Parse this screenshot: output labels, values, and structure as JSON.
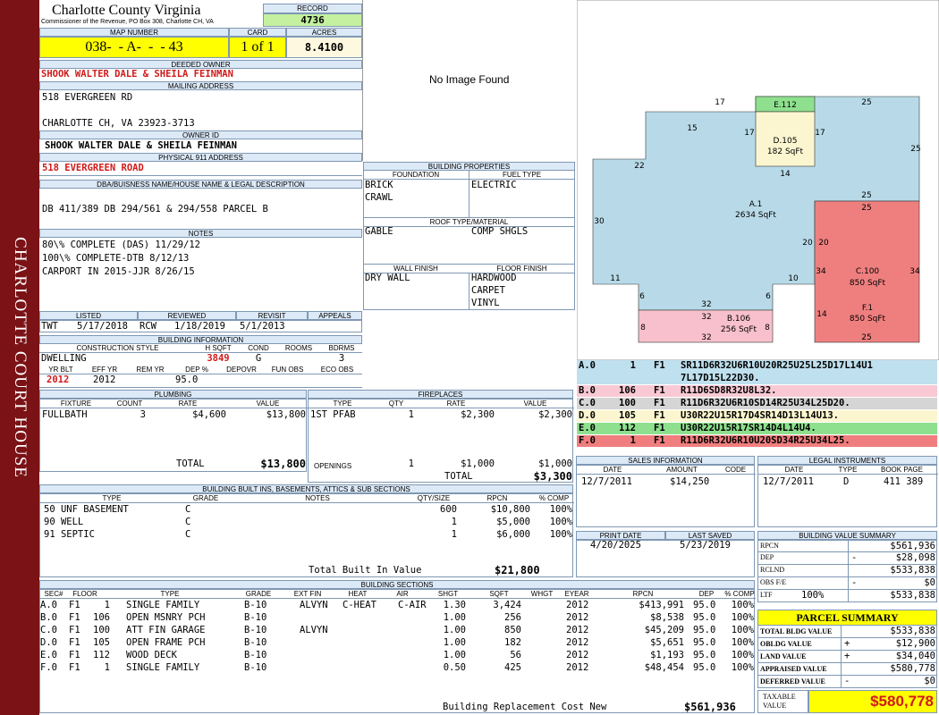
{
  "sidebar": {
    "title": "CHARLOTTE COURT HOUSE"
  },
  "header": {
    "county": "Charlotte County Virginia",
    "subtitle": "Commissioner of the Revenue, PO Box 308, Charlotte CH, VA",
    "record_label": "RECORD",
    "record": "4736",
    "map_label": "MAP NUMBER",
    "map": "038-  - A-  -  - 43",
    "card_label": "CARD",
    "card": "1 of 1",
    "acres_label": "ACRES",
    "acres": "8.4100"
  },
  "owner": {
    "deeded_label": "DEEDED OWNER",
    "deeded": "SHOOK WALTER DALE & SHEILA FEINMAN",
    "mailing_label": "MAILING ADDRESS",
    "mail1": "518 EVERGREEN RD",
    "mail2": "CHARLOTTE CH, VA 23923-3713",
    "id_label": "OWNER ID",
    "id_name": "SHOOK WALTER DALE & SHEILA FEINMAN",
    "phys_label": "PHYSICAL 911 ADDRESS",
    "phys": "518 EVERGREEN ROAD",
    "dba_label": "DBA/BUISNESS NAME/HOUSE NAME & LEGAL DESCRIPTION",
    "dba": "DB 411/389 DB 294/561 & 294/558 PARCEL B",
    "notes_label": "NOTES",
    "notes": [
      "80\\% COMPLETE (DAS) 11/29/12",
      "100\\% COMPLETE-DTB 8/12/13",
      "CARPORT IN 2015-JJR 8/26/15"
    ]
  },
  "dates": {
    "listed_label": "LISTED",
    "listed_by": "TWT",
    "listed": "5/17/2018",
    "reviewed_label": "REVIEWED",
    "reviewed_by": "RCW",
    "reviewed": "1/18/2019",
    "revisit_label": "REVISIT",
    "revisit": "5/1/2013",
    "appeals_label": "APPEALS"
  },
  "bldginfo": {
    "title": "BUILDING INFORMATION",
    "style_label": "CONSTRUCTION STYLE",
    "sqft_label": "H SQFT",
    "cond_label": "COND",
    "rooms_label": "ROOMS",
    "bdrms_label": "BDRMS",
    "style": "DWELLING",
    "sqft": "3849",
    "cond": "G",
    "bdrms": "3",
    "yr_label": "YR BLT",
    "eff_label": "EFF YR",
    "rem_label": "REM YR",
    "dep_label": "DEP %",
    "depovr_label": "DEPOVR",
    "funobs_label": "FUN OBS",
    "ecoobs_label": "ECO OBS",
    "yr": "2012",
    "eff": "2012",
    "dep": "95.0"
  },
  "image": {
    "text": "No Image Found"
  },
  "props": {
    "title": "BUILDING PROPERTIES",
    "foundation_label": "FOUNDATION",
    "fuel_label": "FUEL TYPE",
    "foundation": [
      "BRICK",
      "CRAWL"
    ],
    "fuel": "ELECTRIC",
    "roof_label": "ROOF TYPE/MATERIAL",
    "roof1": "GABLE",
    "roof2": "COMP SHGLS",
    "wall_label": "WALL FINISH",
    "floor_label": "FLOOR FINISH",
    "wall": "DRY WALL",
    "floor": [
      "HARDWOOD",
      "CARPET",
      "VINYL"
    ]
  },
  "sketch": {
    "labels": {
      "a_name": "A.1",
      "a_area": "2634 SqFt",
      "b_name": "B.106",
      "b_area": "256 SqFt",
      "c_name": "C.100",
      "c_area": "850 SqFt",
      "f_name": "F.1",
      "f_area": "850 SqFt",
      "d_name": "D.105",
      "d_area": "182 SqFt",
      "e_name": "E.112"
    },
    "dims": [
      "17",
      "25",
      "15",
      "17",
      "17",
      "25",
      "22",
      "14",
      "30",
      "25",
      "25",
      "20",
      "20",
      "34",
      "34",
      "11",
      "10",
      "6",
      "6",
      "32",
      "32",
      "14",
      "8",
      "8",
      "32",
      "25"
    ]
  },
  "vectors": [
    {
      "code": "A.0",
      "n": "1",
      "f": "F1",
      "v1": "SR11D6R32U6R10U20R25U25L25D17L14U1",
      "v2": "7L17D15L22D30.",
      "color": "#bfe0ee"
    },
    {
      "code": "B.0",
      "n": "106",
      "f": "F1",
      "v1": "R11D6SD8R32U8L32.",
      "color": "#f8c9d4"
    },
    {
      "code": "C.0",
      "n": "100",
      "f": "F1",
      "v1": "R11D6R32U6R10SD14R25U34L25D20.",
      "color": "#d5d5d5"
    },
    {
      "code": "D.0",
      "n": "105",
      "f": "F1",
      "v1": "U30R22U15R17D4SR14D13L14U13.",
      "color": "#fbf6cf"
    },
    {
      "code": "E.0",
      "n": "112",
      "f": "F1",
      "v1": "U30R22U15R17SR14D4L14U4.",
      "color": "#8ee08e"
    },
    {
      "code": "F.0",
      "n": "1",
      "f": "F1",
      "v1": "R11D6R32U6R10U20SD34R25U34L25.",
      "color": "#f07e7e"
    }
  ],
  "plumbing": {
    "title": "PLUMBING",
    "headers": [
      "FIXTURE",
      "COUNT",
      "RATE",
      "VALUE"
    ],
    "rows": [
      {
        "fixture": "FULLBATH",
        "count": "3",
        "rate": "$4,600",
        "value": "$13,800"
      }
    ],
    "total_label": "TOTAL",
    "total": "$13,800"
  },
  "fireplaces": {
    "title": "FIREPLACES",
    "headers": [
      "TYPE",
      "QTY",
      "RATE",
      "VALUE"
    ],
    "rows": [
      {
        "type": "1ST PFAB",
        "qty": "1",
        "rate": "$2,300",
        "value": "$2,300"
      }
    ],
    "openings_label": "OPENINGS",
    "op_qty": "1",
    "op_rate": "$1,000",
    "op_value": "$1,000",
    "total_label": "TOTAL",
    "total": "$3,300"
  },
  "builtins": {
    "title": "BUILDING BUILT INS, BASEMENTS, ATTICS & SUB SECTIONS",
    "headers": [
      "TYPE",
      "GRADE",
      "NOTES",
      "QTY/SIZE",
      "RPCN",
      "% COMP"
    ],
    "rows": [
      {
        "type": "50 UNF BASEMENT",
        "grade": "C",
        "qty": "600",
        "rpcn": "$10,800",
        "comp": "100%"
      },
      {
        "type": "90 WELL",
        "grade": "C",
        "qty": "1",
        "rpcn": "$5,000",
        "comp": "100%"
      },
      {
        "type": "91 SEPTIC",
        "grade": "C",
        "qty": "1",
        "rpcn": "$6,000",
        "comp": "100%"
      }
    ],
    "total_label": "Total Built In Value",
    "total": "$21,800"
  },
  "sales": {
    "title": "SALES INFORMATION",
    "headers": [
      "DATE",
      "AMOUNT",
      "CODE"
    ],
    "rows": [
      {
        "date": "12/7/2011",
        "amount": "$14,250",
        "code": ""
      }
    ]
  },
  "legal": {
    "title": "LEGAL INSTRUMENTS",
    "headers": [
      "DATE",
      "TYPE",
      "BOOK PAGE"
    ],
    "rows": [
      {
        "date": "12/7/2011",
        "type": "D",
        "book": "411 389"
      }
    ]
  },
  "print": {
    "print_label": "PRINT DATE",
    "print": "4/20/2025",
    "saved_label": "LAST SAVED",
    "saved": "5/23/2019"
  },
  "sections": {
    "title": "BUILDING SECTIONS",
    "headers": [
      "SEC#",
      "FLOOR",
      "TYPE",
      "GRADE",
      "EXT FIN",
      "HEAT",
      "AIR",
      "SHGT",
      "SQFT",
      "WHGT",
      "EYEAR",
      "RPCN",
      "DEP",
      "% COMP"
    ],
    "rows": [
      {
        "sec": "A.0",
        "floor": "F1",
        "num": "1",
        "type": "SINGLE FAMILY",
        "grade": "B-10",
        "ext": "ALVYN",
        "heat": "C-HEAT",
        "air": "C-AIR",
        "shgt": "1.30",
        "sqft": "3,424",
        "eyear": "2012",
        "rpcn": "$413,991",
        "dep": "95.0",
        "comp": "100%"
      },
      {
        "sec": "B.0",
        "floor": "F1",
        "num": "106",
        "type": "OPEN MSNRY PCH",
        "grade": "B-10",
        "ext": "",
        "heat": "",
        "air": "",
        "shgt": "1.00",
        "sqft": "256",
        "eyear": "2012",
        "rpcn": "$8,538",
        "dep": "95.0",
        "comp": "100%"
      },
      {
        "sec": "C.0",
        "floor": "F1",
        "num": "100",
        "type": "ATT FIN GARAGE",
        "grade": "B-10",
        "ext": "ALVYN",
        "heat": "",
        "air": "",
        "shgt": "1.00",
        "sqft": "850",
        "eyear": "2012",
        "rpcn": "$45,209",
        "dep": "95.0",
        "comp": "100%"
      },
      {
        "sec": "D.0",
        "floor": "F1",
        "num": "105",
        "type": "OPEN FRAME PCH",
        "grade": "B-10",
        "ext": "",
        "heat": "",
        "air": "",
        "shgt": "1.00",
        "sqft": "182",
        "eyear": "2012",
        "rpcn": "$5,651",
        "dep": "95.0",
        "comp": "100%"
      },
      {
        "sec": "E.0",
        "floor": "F1",
        "num": "112",
        "type": "WOOD DECK",
        "grade": "B-10",
        "ext": "",
        "heat": "",
        "air": "",
        "shgt": "1.00",
        "sqft": "56",
        "eyear": "2012",
        "rpcn": "$1,193",
        "dep": "95.0",
        "comp": "100%"
      },
      {
        "sec": "F.0",
        "floor": "F1",
        "num": "1",
        "type": "SINGLE FAMILY",
        "grade": "B-10",
        "ext": "",
        "heat": "",
        "air": "",
        "shgt": "0.50",
        "sqft": "425",
        "eyear": "2012",
        "rpcn": "$48,454",
        "dep": "95.0",
        "comp": "100%"
      }
    ],
    "total_label": "Building Replacement Cost New",
    "total": "$561,936"
  },
  "valuesummary": {
    "title": "BUILDING VALUE SUMMARY",
    "rows": [
      {
        "label": "RPCN",
        "sign": "",
        "pct": "",
        "value": "$561,936"
      },
      {
        "label": "DEP",
        "sign": "-",
        "pct": "",
        "value": "$28,098"
      },
      {
        "label": "RCLND",
        "sign": "",
        "pct": "",
        "value": "$533,838"
      },
      {
        "label": "OBS F/E",
        "sign": "-",
        "pct": "",
        "value": "$0"
      },
      {
        "label": "LTF",
        "sign": "",
        "pct": "100%",
        "value": "$533,838"
      }
    ]
  },
  "parcel": {
    "title": "PARCEL SUMMARY",
    "rows": [
      {
        "label": "TOTAL BLDG VALUE",
        "sign": "",
        "value": "$533,838"
      },
      {
        "label": "OBLDG VALUE",
        "sign": "+",
        "value": "$12,900"
      },
      {
        "label": "LAND VALUE",
        "sign": "+",
        "value": "$34,040"
      },
      {
        "label": "APPRAISED VALUE",
        "sign": "",
        "value": "$580,778"
      },
      {
        "label": "DEFERRED VALUE",
        "sign": "-",
        "value": "$0"
      }
    ],
    "taxable_label1": "TAXABLE",
    "taxable_label2": "VALUE",
    "taxable": "$580,778"
  }
}
